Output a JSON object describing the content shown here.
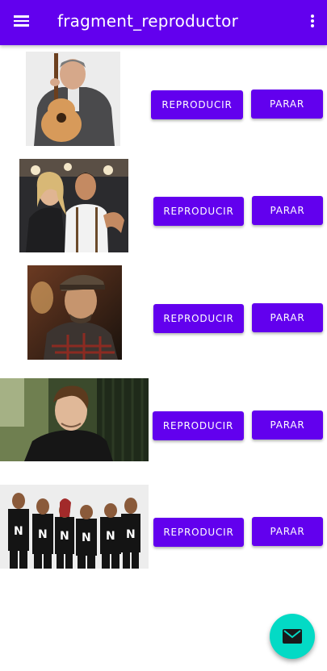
{
  "app_bar": {
    "title": "fragment_reproductor",
    "menu_icon": "hamburger-menu-icon",
    "overflow_icon": "more-vert-icon"
  },
  "colors": {
    "primary": "#6200EE",
    "accent": "#03DAC5",
    "background": "#FFFFFF"
  },
  "tracks": [
    {
      "photo": "artist-photo-1",
      "play_label": "REPRODUCIR",
      "stop_label": "PARAR"
    },
    {
      "photo": "artist-photo-2",
      "play_label": "REPRODUCIR",
      "stop_label": "PARAR"
    },
    {
      "photo": "artist-photo-3",
      "play_label": "REPRODUCIR",
      "stop_label": "PARAR"
    },
    {
      "photo": "artist-photo-4",
      "play_label": "REPRODUCIR",
      "stop_label": "PARAR"
    },
    {
      "photo": "artist-photo-5",
      "play_label": "REPRODUCIR",
      "stop_label": "PARAR"
    }
  ],
  "fab": {
    "icon": "email-icon"
  }
}
